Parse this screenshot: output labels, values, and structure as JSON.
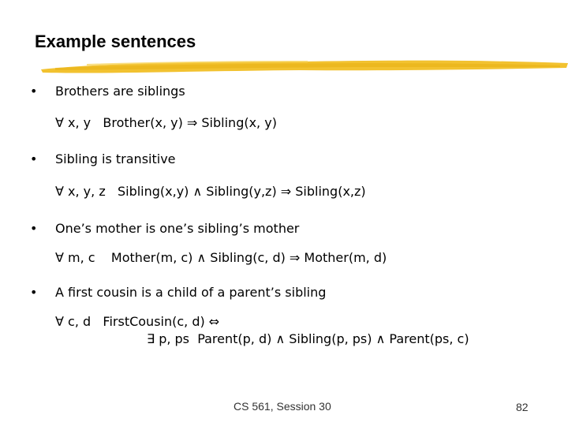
{
  "title": "Example sentences",
  "colors": {
    "accent_stroke": "#f2c230",
    "text": "#000000",
    "footer_text": "#333333"
  },
  "items": [
    {
      "bullet": "•",
      "text": "Brothers are siblings",
      "formula": [
        "∀ x, y   Brother(x, y) ⇒ Sibling(x, y)"
      ]
    },
    {
      "bullet": "•",
      "text": "Sibling is transitive",
      "formula": [
        "∀ x, y, z   Sibling(x,y) ∧ Sibling(y,z) ⇒ Sibling(x,z)"
      ]
    },
    {
      "bullet": "•",
      "text": "One’s mother is one’s sibling’s mother",
      "formula": [
        "∀ m, c    Mother(m, c) ∧ Sibling(c, d) ⇒ Mother(m, d)"
      ]
    },
    {
      "bullet": "•",
      "text": "A first cousin is a child of a parent’s sibling",
      "formula": [
        "∀ c, d   FirstCousin(c, d) ⇔",
        "∃ p, ps  Parent(p, d) ∧ Sibling(p, ps) ∧ Parent(ps, c)"
      ]
    }
  ],
  "footer": {
    "course": "CS 561,  Session 30",
    "page_number": "82"
  }
}
